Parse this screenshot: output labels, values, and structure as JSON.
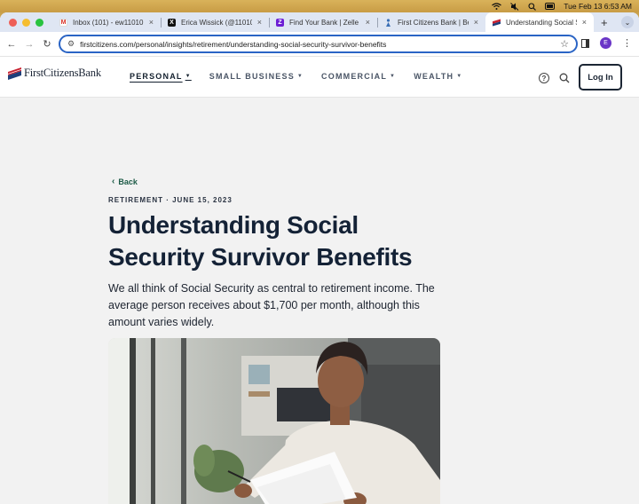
{
  "menubar": {
    "datetime": "Tue Feb 13  6:53 AM"
  },
  "browser": {
    "tabs": [
      {
        "title": "Inbox (101) - ew11010@g",
        "icon": "gmail-icon",
        "active": false
      },
      {
        "title": "Erica Wissick (@11010er",
        "icon": "x-icon",
        "active": false
      },
      {
        "title": "Find Your Bank | Zelle En",
        "icon": "zelle-icon",
        "active": false
      },
      {
        "title": "First Citizens Bank | Bett",
        "icon": "firstcitizens-icon",
        "active": false
      },
      {
        "title": "Understanding Social Se",
        "icon": "firstcitizens-flag-icon",
        "active": true
      }
    ],
    "new_tab": "+",
    "url": "firstcitizens.com/personal/insights/retirement/understanding-social-security-survivor-benefits",
    "profile_initial": "E"
  },
  "site": {
    "logo_text": "FirstCitizensBank",
    "nav": [
      {
        "label": "PERSONAL",
        "active": true
      },
      {
        "label": "SMALL BUSINESS",
        "active": false
      },
      {
        "label": "COMMERCIAL",
        "active": false
      },
      {
        "label": "WEALTH",
        "active": false
      }
    ],
    "help_glyph": "?",
    "login_label": "Log In"
  },
  "article": {
    "back_label": "Back",
    "eyebrow": "RETIREMENT · JUNE 15, 2023",
    "title_line1": "Understanding Social",
    "title_line2": "Security Survivor Benefits",
    "lede_line1": "We all think of Social Security as central to retirement income. The",
    "lede_line2": "average person receives about $1,700 per month, although this",
    "lede_line3": "amount varies widely."
  },
  "colors": {
    "brand_navy": "#142236",
    "back_green": "#1d5b47",
    "omnibox_blue": "#2a64c5"
  }
}
